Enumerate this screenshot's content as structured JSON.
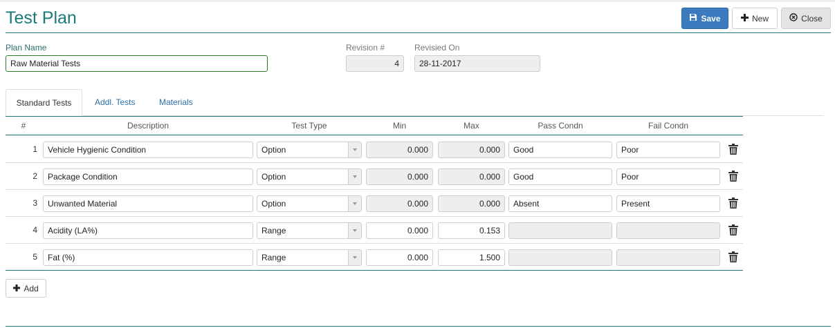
{
  "page": {
    "title": "Test Plan"
  },
  "toolbar": {
    "save_label": "Save",
    "new_label": "New",
    "close_label": "Close"
  },
  "form": {
    "plan_name_label": "Plan Name",
    "plan_name_value": "Raw Material Tests",
    "revision_label": "Revision #",
    "revision_value": "4",
    "revised_on_label": "Revisied On",
    "revised_on_value": "28-11-2017"
  },
  "tabs": [
    {
      "label": "Standard Tests",
      "active": true
    },
    {
      "label": "Addl. Tests",
      "active": false
    },
    {
      "label": "Materials",
      "active": false
    }
  ],
  "table": {
    "columns": [
      "#",
      "Description",
      "Test Type",
      "Min",
      "Max",
      "Pass Condn",
      "Fail Condn"
    ],
    "rows": [
      {
        "num": "1",
        "description": "Vehicle Hygienic Condition",
        "test_type": "Option",
        "min": "0.000",
        "max": "0.000",
        "pass": "Good",
        "fail": "Poor"
      },
      {
        "num": "2",
        "description": "Package Condition",
        "test_type": "Option",
        "min": "0.000",
        "max": "0.000",
        "pass": "Good",
        "fail": "Poor"
      },
      {
        "num": "3",
        "description": "Unwanted Material",
        "test_type": "Option",
        "min": "0.000",
        "max": "0.000",
        "pass": "Absent",
        "fail": "Present"
      },
      {
        "num": "4",
        "description": "Acidity (LA%)",
        "test_type": "Range",
        "min": "0.000",
        "max": "0.153",
        "pass": "",
        "fail": ""
      },
      {
        "num": "5",
        "description": "Fat (%)",
        "test_type": "Range",
        "min": "0.000",
        "max": "1.500",
        "pass": "",
        "fail": ""
      }
    ]
  },
  "add_button_label": "Add",
  "icons": {
    "save": "floppy-disk-icon",
    "new": "plus-icon",
    "close": "close-circle-icon",
    "delete": "trash-icon",
    "add": "plus-icon",
    "dropdown": "caret-down-icon"
  },
  "colors": {
    "accent": "#1b7a7a",
    "primary": "#3a7bbf",
    "link": "#2b6ea6"
  }
}
